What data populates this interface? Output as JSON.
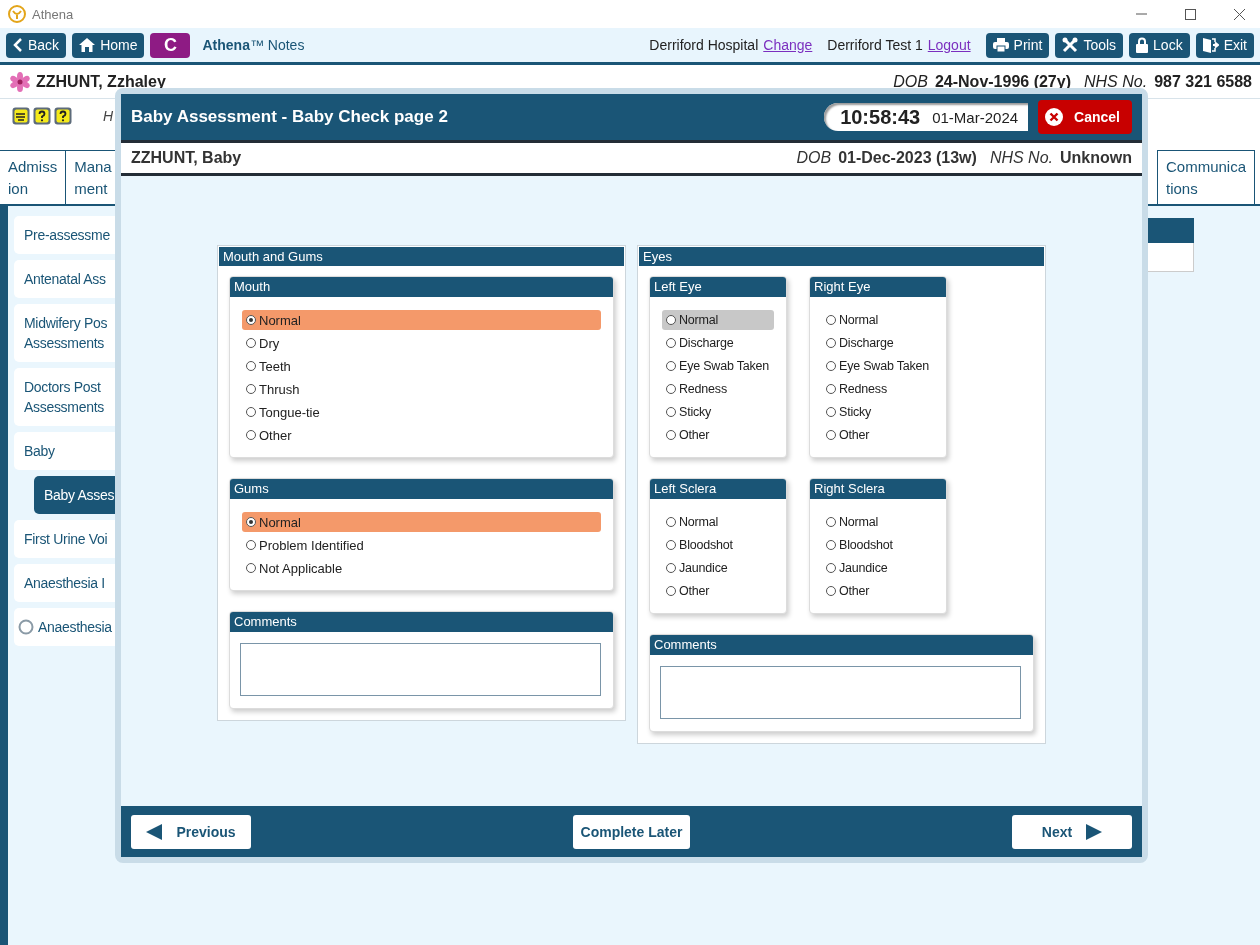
{
  "window": {
    "title": "Athena"
  },
  "toolbar": {
    "left_buttons": [
      {
        "kind": "back",
        "label": "Back"
      },
      {
        "kind": "home",
        "label": "Home"
      }
    ],
    "app_badge": "C",
    "app_name": "**Athena**™ Notes",
    "location": "Derriford Hospital",
    "change_link": "Change",
    "user": "Derriford Test 1",
    "logout_link": "Logout",
    "right_buttons": [
      {
        "kind": "print",
        "label": "Print"
      },
      {
        "kind": "tools",
        "label": "Tools"
      },
      {
        "kind": "lock",
        "label": "Lock"
      },
      {
        "kind": "exit",
        "label": "Exit"
      }
    ]
  },
  "patient": {
    "name": "ZZHUNT, Zzhaley",
    "dob_label": "DOB",
    "dob": "24-Nov-1996 (27y)",
    "nhs_label": "NHS No.",
    "nhs": "987 321 6588"
  },
  "alert_text": "H",
  "tabs": [
    {
      "lines": [
        "Admiss",
        "ion"
      ]
    },
    {
      "lines": [
        "Mana",
        "ment"
      ]
    },
    {
      "lines": [
        "Communica",
        "tions"
      ]
    }
  ],
  "sidebar": {
    "items": [
      {
        "kind": "item",
        "lines": [
          "Pre-assessme"
        ],
        "selected": false
      },
      {
        "kind": "item",
        "lines": [
          "Antenatal Ass"
        ],
        "selected": false
      },
      {
        "kind": "item",
        "lines": [
          "Midwifery Pos",
          "Assessments"
        ],
        "selected": false
      },
      {
        "kind": "item",
        "lines": [
          "Doctors Post",
          "Assessments"
        ],
        "selected": false
      },
      {
        "kind": "item",
        "lines": [
          "Baby"
        ],
        "selected": false
      },
      {
        "kind": "sub",
        "lines": [
          "Baby Asses"
        ],
        "selected": true
      },
      {
        "kind": "item",
        "lines": [
          "First Urine Voi"
        ],
        "selected": false
      },
      {
        "kind": "item",
        "lines": [
          "Anaesthesia I"
        ],
        "selected": false
      },
      {
        "kind": "radio",
        "lines": [
          "Anaesthesia"
        ],
        "selected": false
      }
    ]
  },
  "modal": {
    "title": "Baby Assessment - Baby Check page 2",
    "time": "10:58:43",
    "date": "01-Mar-2024",
    "cancel": "Cancel",
    "patient": {
      "name": "ZZHUNT, Baby",
      "dob_label": "DOB",
      "dob": "01-Dec-2023 (13w)",
      "nhs_label": "NHS No.",
      "nhs": "Unknown"
    },
    "sections": [
      {
        "title": "Mouth and Gums",
        "rows": [
          [
            {
              "kind": "radio",
              "title": "Mouth",
              "options": [
                {
                  "label": "Normal",
                  "selected": true,
                  "focused": false
                },
                {
                  "label": "Dry",
                  "selected": false,
                  "focused": false
                },
                {
                  "label": "Teeth",
                  "selected": false,
                  "focused": false
                },
                {
                  "label": "Thrush",
                  "selected": false,
                  "focused": false
                },
                {
                  "label": "Tongue-tie",
                  "selected": false,
                  "focused": false
                },
                {
                  "label": "Other",
                  "selected": false,
                  "focused": false
                }
              ]
            }
          ],
          [
            {
              "kind": "radio",
              "title": "Gums",
              "options": [
                {
                  "label": "Normal",
                  "selected": true,
                  "focused": false
                },
                {
                  "label": "Problem Identified",
                  "selected": false,
                  "focused": false
                },
                {
                  "label": "Not Applicable",
                  "selected": false,
                  "focused": false
                }
              ]
            }
          ],
          [
            {
              "kind": "comments",
              "title": "Comments"
            }
          ]
        ]
      },
      {
        "title": "Eyes",
        "rows": [
          [
            {
              "kind": "radio",
              "title": "Left Eye",
              "options": [
                {
                  "label": "Normal",
                  "selected": false,
                  "focused": true
                },
                {
                  "label": "Discharge",
                  "selected": false,
                  "focused": false
                },
                {
                  "label": "Eye Swab Taken",
                  "selected": false,
                  "focused": false
                },
                {
                  "label": "Redness",
                  "selected": false,
                  "focused": false
                },
                {
                  "label": "Sticky",
                  "selected": false,
                  "focused": false
                },
                {
                  "label": "Other",
                  "selected": false,
                  "focused": false
                }
              ]
            },
            {
              "kind": "radio",
              "title": "Right Eye",
              "options": [
                {
                  "label": "Normal",
                  "selected": false,
                  "focused": false
                },
                {
                  "label": "Discharge",
                  "selected": false,
                  "focused": false
                },
                {
                  "label": "Eye Swab Taken",
                  "selected": false,
                  "focused": false
                },
                {
                  "label": "Redness",
                  "selected": false,
                  "focused": false
                },
                {
                  "label": "Sticky",
                  "selected": false,
                  "focused": false
                },
                {
                  "label": "Other",
                  "selected": false,
                  "focused": false
                }
              ]
            }
          ],
          [
            {
              "kind": "radio",
              "title": "Left Sclera",
              "options": [
                {
                  "label": "Normal",
                  "selected": false,
                  "focused": false
                },
                {
                  "label": "Bloodshot",
                  "selected": false,
                  "focused": false
                },
                {
                  "label": "Jaundice",
                  "selected": false,
                  "focused": false
                },
                {
                  "label": "Other",
                  "selected": false,
                  "focused": false
                }
              ]
            },
            {
              "kind": "radio",
              "title": "Right Sclera",
              "options": [
                {
                  "label": "Normal",
                  "selected": false,
                  "focused": false
                },
                {
                  "label": "Bloodshot",
                  "selected": false,
                  "focused": false
                },
                {
                  "label": "Jaundice",
                  "selected": false,
                  "focused": false
                },
                {
                  "label": "Other",
                  "selected": false,
                  "focused": false
                }
              ]
            }
          ],
          [
            {
              "kind": "comments",
              "title": "Comments"
            }
          ]
        ]
      }
    ],
    "footer": {
      "previous": "Previous",
      "complete_later": "Complete Later",
      "next": "Next"
    }
  }
}
